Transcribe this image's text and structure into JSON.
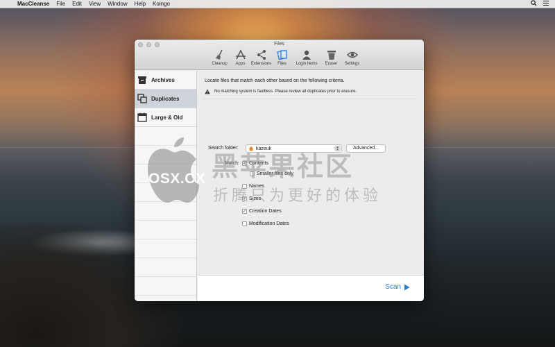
{
  "menubar": {
    "app_name": "MacCleanse",
    "items": [
      "File",
      "Edit",
      "View",
      "Window",
      "Help",
      "Koingo"
    ]
  },
  "window": {
    "title": "Files",
    "toolbar": [
      {
        "label": "Cleanup",
        "icon": "broom-icon"
      },
      {
        "label": "Apps",
        "icon": "apps-icon"
      },
      {
        "label": "Extensions",
        "icon": "share-icon"
      },
      {
        "label": "Files",
        "icon": "files-icon"
      },
      {
        "label": "Login Items",
        "icon": "person-icon"
      },
      {
        "label": "Eraser",
        "icon": "trash-icon"
      },
      {
        "label": "Settings",
        "icon": "settings-icon"
      }
    ]
  },
  "sidebar": {
    "items": [
      {
        "label": "Archives",
        "icon": "archive-box-icon"
      },
      {
        "label": "Duplicates",
        "icon": "duplicates-icon",
        "selected": true
      },
      {
        "label": "Large & Old",
        "icon": "calendar-icon"
      }
    ]
  },
  "main": {
    "description": "Locate files that match each other based on the following criteria.",
    "warning": "No matching system is faultless. Please review all duplicates prior to erasure.",
    "search_folder_label": "Search folder:",
    "search_folder_value": "kazeuk",
    "advanced_label": "Advanced...",
    "match_label": "Match:",
    "options": {
      "contents": {
        "label": "Contents",
        "checked": true
      },
      "smaller_only": {
        "label": "Smaller files only",
        "checked": false
      },
      "names": {
        "label": "Names",
        "checked": false
      },
      "sizes": {
        "label": "Sizes",
        "checked": true
      },
      "creation_dates": {
        "label": "Creation Dates",
        "checked": true
      },
      "modification_dates": {
        "label": "Modification Dates",
        "checked": false
      }
    },
    "scan_label": "Scan"
  },
  "watermark": {
    "site": "OSX.CX",
    "title": "黑苹果社区",
    "subtitle": "折腾只为更好的体验"
  },
  "colors": {
    "accent": "#2a7ad4",
    "sidebar_selected": "#cfd3da"
  }
}
